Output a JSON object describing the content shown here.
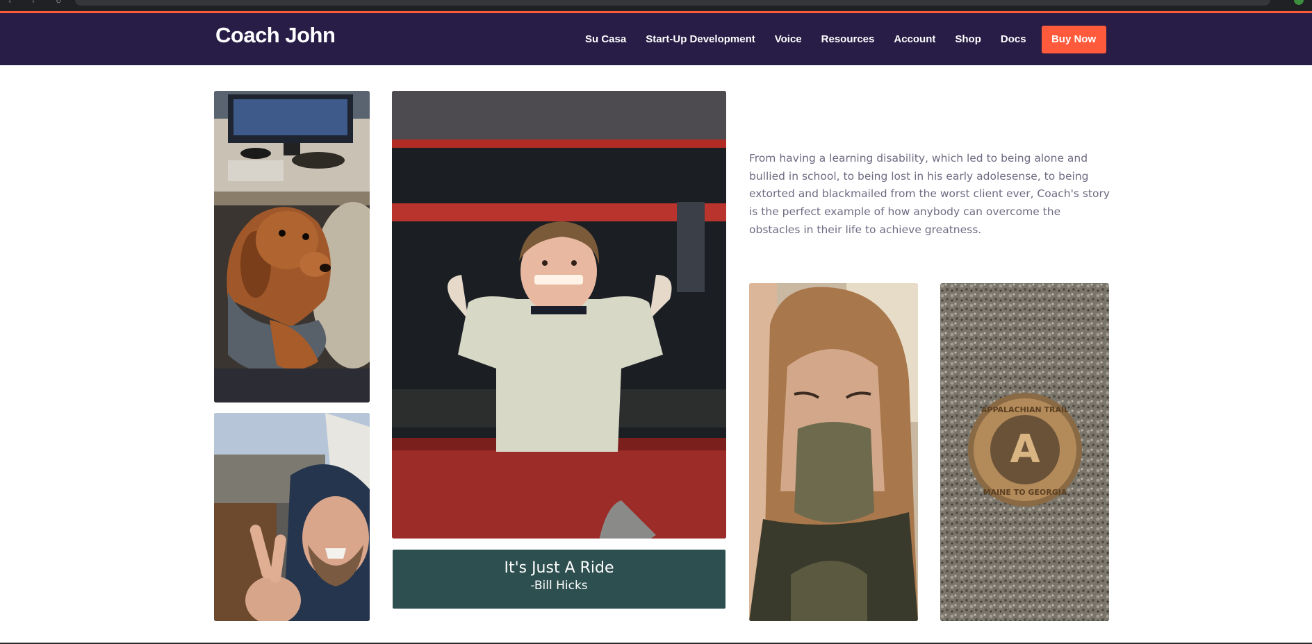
{
  "header": {
    "brand": "Coach John",
    "nav": [
      "Su Casa",
      "Start-Up Development",
      "Voice",
      "Resources",
      "Account",
      "Shop",
      "Docs"
    ],
    "cta": "Buy Now"
  },
  "colors": {
    "header_bg": "#271d47",
    "accent": "#ff5a3c",
    "quote_bg": "#2e4f4f",
    "body_text": "#6d6b82"
  },
  "main": {
    "story": "From having a learning disability, which led to being alone and bullied in school, to being lost in his early adolesense, to being extorted and blackmailed from the worst client ever, Coach's story is the perfect example of how anybody can overcome the obstacles in their life to achieve greatness.",
    "quote": {
      "text": "It's Just A Ride",
      "author": "-Bill Hicks"
    },
    "trail_marker": {
      "top": "APPALACHIAN TRAIL",
      "bottom": "MAINE TO GEORGIA",
      "letter": "A"
    }
  }
}
